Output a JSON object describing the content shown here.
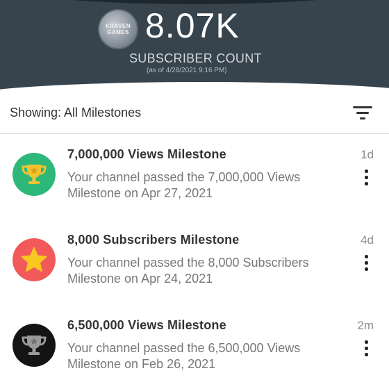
{
  "header": {
    "avatar_text": "KRAVEN GAMES",
    "subscriber_count": "8.07K",
    "subscriber_label": "SUBSCRIBER COUNT",
    "as_of": "(as of 4/28/2021 9:16 PM)"
  },
  "filter": {
    "label": "Showing: All Milestones",
    "icon": "filter-icon"
  },
  "milestones": [
    {
      "title": "7,000,000 Views Milestone",
      "description": "Your channel passed the 7,000,000 Views Milestone on Apr 27, 2021",
      "time": "1d",
      "icon": "trophy-icon",
      "badge_color": "#2db87a",
      "icon_color": "#f2c230"
    },
    {
      "title": "8,000 Subscribers Milestone",
      "description": "Your channel passed the 8,000 Subscribers Milestone on Apr 24, 2021",
      "time": "4d",
      "icon": "star-icon",
      "badge_color": "#f25a5a",
      "icon_color": "#f7c820"
    },
    {
      "title": "6,500,000 Views Milestone",
      "description": "Your channel passed the 6,500,000 Views Milestone on Feb 26, 2021",
      "time": "2m",
      "icon": "trophy-icon",
      "badge_color": "#141414",
      "icon_color": "#9a9a9a"
    }
  ]
}
